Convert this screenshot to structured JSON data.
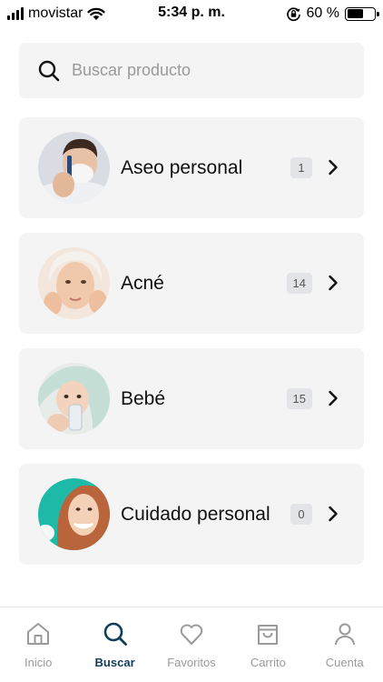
{
  "status_bar": {
    "carrier": "movistar",
    "time": "5:34 p. m.",
    "battery_percent": "60 %",
    "battery_level": 0.6,
    "icons": [
      "signal-icon",
      "wifi-icon",
      "rotation-lock-icon",
      "battery-icon"
    ]
  },
  "search": {
    "placeholder": "Buscar producto",
    "icon": "search-icon"
  },
  "categories": [
    {
      "label": "Aseo personal",
      "count": "1",
      "image": "man-shaving-photo"
    },
    {
      "label": "Acné",
      "count": "14",
      "image": "woman-skincare-photo"
    },
    {
      "label": "Bebé",
      "count": "15",
      "image": "baby-bottle-photo"
    },
    {
      "label": "Cuidado personal",
      "count": "0",
      "image": "smiling-woman-photo"
    }
  ],
  "bottom_nav": {
    "items": [
      {
        "label": "Inicio",
        "icon": "home-icon",
        "active": false
      },
      {
        "label": "Buscar",
        "icon": "search-icon",
        "active": true
      },
      {
        "label": "Favoritos",
        "icon": "heart-icon",
        "active": false
      },
      {
        "label": "Carrito",
        "icon": "bag-icon",
        "active": false
      },
      {
        "label": "Cuenta",
        "icon": "user-icon",
        "active": false
      }
    ],
    "active_color": "#0f3d5a",
    "inactive_color": "#9a9a9a"
  }
}
